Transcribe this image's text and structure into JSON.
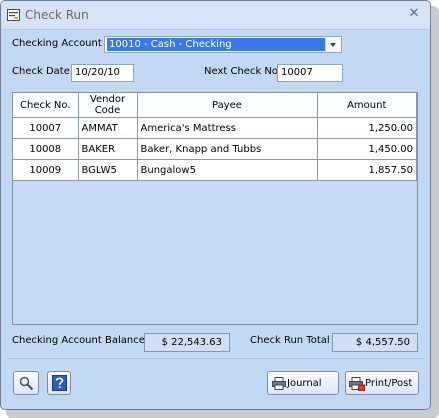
{
  "window": {
    "title": "Check Run"
  },
  "form": {
    "account_label": "Checking Account",
    "account_value": "10010 - Cash - Checking",
    "date_label": "Check Date",
    "date_value": "10/20/10",
    "next_check_label": "Next Check No.",
    "next_check_value": "10007"
  },
  "table": {
    "headers": [
      "Check No.",
      "Vendor Code",
      "Payee",
      "Amount"
    ],
    "rows": [
      [
        "10007",
        "AMMAT",
        "America's Mattress",
        "1,250.00"
      ],
      [
        "10008",
        "BAKER",
        "Baker, Knapp and Tubbs",
        "1,450.00"
      ],
      [
        "10009",
        "BGLW5",
        "Bungalow5",
        "1,857.50"
      ]
    ]
  },
  "summary": {
    "balance_label": "Checking Account Balance",
    "balance_value": "$ 22,543.63",
    "total_label": "Check Run Total",
    "total_value": "$ 4,557.50"
  },
  "buttons": {
    "journal": "Journal",
    "print_post": "Print/Post"
  },
  "icons": {
    "window": "app-icon",
    "close": "close-icon",
    "zoom": "magnifier-icon",
    "help": "help-icon",
    "journal": "printer-icon",
    "print_post": "printer-post-icon",
    "dropdown": "chevron-down-icon"
  },
  "colors": {
    "window_bg": "#c3d9f3",
    "selection": "#3b78e7"
  }
}
